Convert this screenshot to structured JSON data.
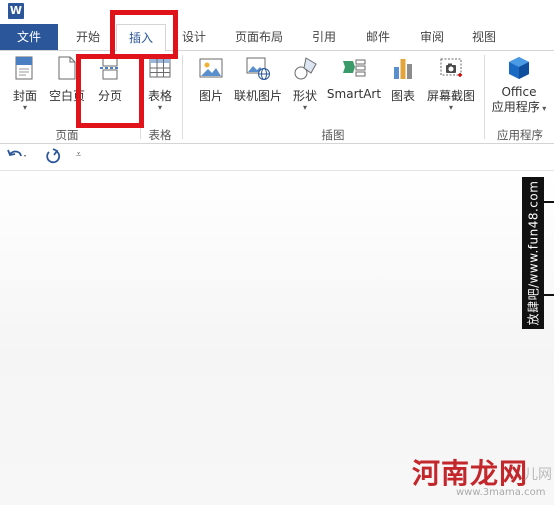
{
  "app": {
    "logo_text": "W"
  },
  "tabs": [
    {
      "label": "文件"
    },
    {
      "label": "开始"
    },
    {
      "label": "插入"
    },
    {
      "label": "设计"
    },
    {
      "label": "页面布局"
    },
    {
      "label": "引用"
    },
    {
      "label": "邮件"
    },
    {
      "label": "审阅"
    },
    {
      "label": "视图"
    }
  ],
  "ribbon": {
    "groups": {
      "pages": {
        "label": "页面",
        "buttons": [
          {
            "label": "封面"
          },
          {
            "label": "空白页"
          },
          {
            "label": "分页"
          }
        ]
      },
      "tables": {
        "label": "表格",
        "buttons": [
          {
            "label": "表格"
          }
        ]
      },
      "illustrations": {
        "label": "插图",
        "buttons": [
          {
            "label": "图片"
          },
          {
            "label": "联机图片"
          },
          {
            "label": "形状"
          },
          {
            "label": "SmartArt"
          },
          {
            "label": "图表"
          },
          {
            "label": "屏幕截图"
          }
        ]
      },
      "apps": {
        "label": "应用程序",
        "buttons": [
          {
            "label": "Office\n应用程序"
          }
        ]
      }
    }
  },
  "office_apps_line1": "Office",
  "office_apps_line2": "应用程序",
  "watermarks": {
    "vertical": "放肆吧/www.fun48.com",
    "big": "河南龙网",
    "small": "www.3mama.com",
    "er": "儿网"
  },
  "colors": {
    "accent": "#2b579a",
    "highlight": "#e0131a"
  }
}
